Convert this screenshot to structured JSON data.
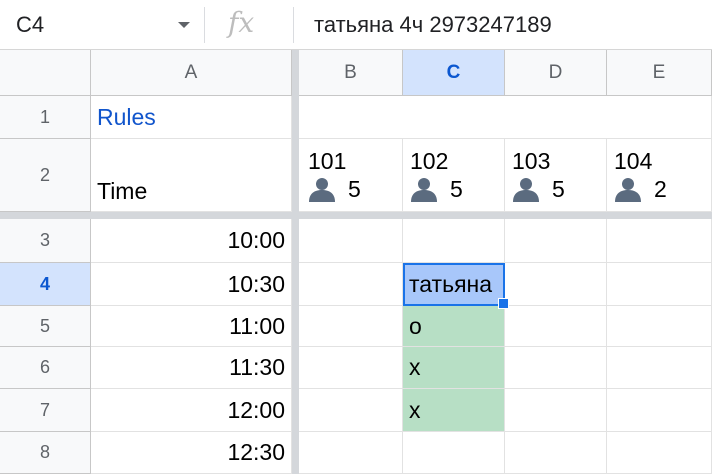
{
  "formula_bar": {
    "cell_ref": "C4",
    "fx_label": "fx",
    "value": "татьяна 4ч 2973247189"
  },
  "columns": [
    "A",
    "B",
    "C",
    "D",
    "E"
  ],
  "selected_column": "C",
  "rows": [
    "1",
    "2",
    "3",
    "4",
    "5",
    "6",
    "7",
    "8"
  ],
  "selected_row": "4",
  "cells": {
    "A1": "Rules",
    "A2": "Time",
    "A3": "10:00",
    "A4": "10:30",
    "A5": "11:00",
    "A6": "11:30",
    "A7": "12:00",
    "A8": "12:30",
    "C4": "татьяна",
    "C5": "o",
    "C6": "x",
    "C7": "x"
  },
  "rooms": [
    {
      "col": "B",
      "number": "101",
      "capacity": "5"
    },
    {
      "col": "C",
      "number": "102",
      "capacity": "5"
    },
    {
      "col": "D",
      "number": "103",
      "capacity": "5"
    },
    {
      "col": "E",
      "number": "104",
      "capacity": "2"
    }
  ],
  "colors": {
    "selection": "#1a73e8",
    "header_highlight": "#d3e3fd",
    "booked_green": "#b7dfc5",
    "link": "#1155cc"
  },
  "icons": {
    "capacity": "person-icon",
    "name_box": "chevron-down-icon"
  }
}
